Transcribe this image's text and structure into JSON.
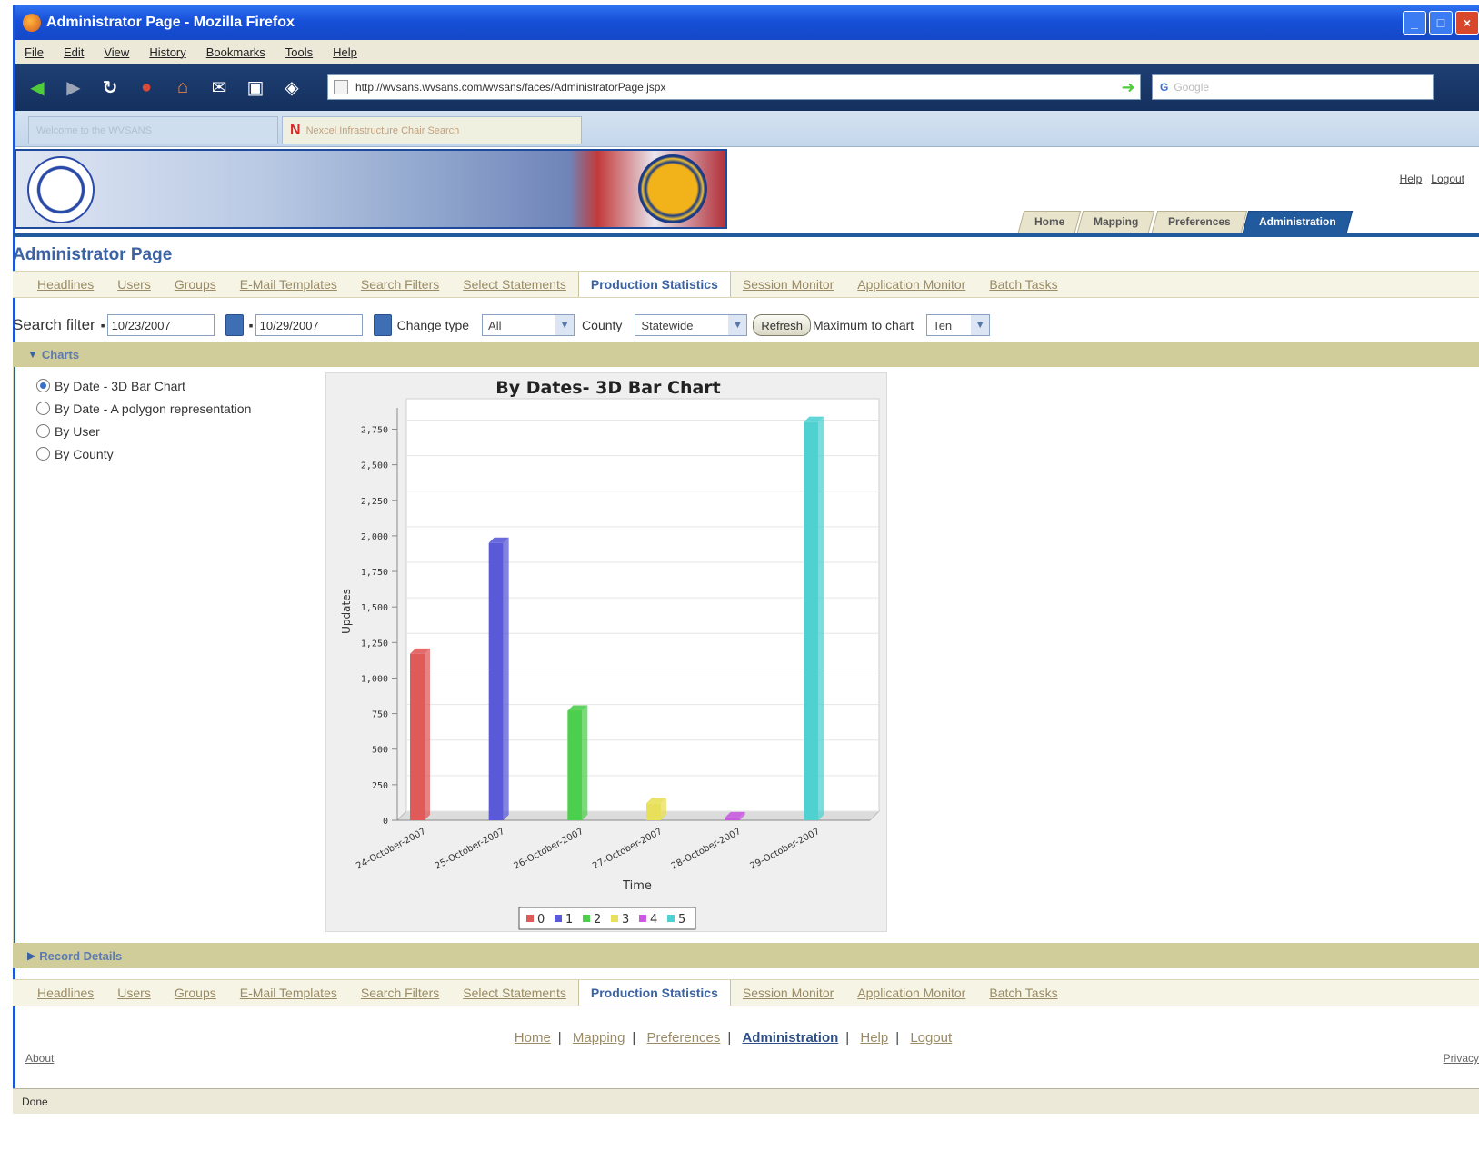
{
  "browser": {
    "window_title": "Administrator Page - Mozilla Firefox",
    "menu": [
      "File",
      "Edit",
      "View",
      "History",
      "Bookmarks",
      "Tools",
      "Help"
    ],
    "url": "http://wvsans.wvsans.com/wvsans/faces/AdministratorPage.jspx",
    "search_placeholder": "Google",
    "tabs": [
      "Welcome to the WVSANS",
      "Nexcel Infrastructure Chair Search"
    ],
    "status": "Done"
  },
  "header": {
    "links": [
      "Help",
      "Logout"
    ],
    "main_tabs": [
      "Home",
      "Mapping",
      "Preferences",
      "Administration"
    ],
    "active_main_tab": "Administration"
  },
  "page": {
    "title": "Administrator Page",
    "subnav": [
      "Headlines",
      "Users",
      "Groups",
      "E-Mail Templates",
      "Search Filters",
      "Select Statements",
      "Production Statistics",
      "Session Monitor",
      "Application Monitor",
      "Batch Tasks"
    ],
    "active_subnav": "Production Statistics"
  },
  "filter": {
    "label": "Search filter",
    "from_date": "10/23/2007",
    "to_date": "10/29/2007",
    "change_type_label": "Change type",
    "change_type_value": "All",
    "county_label": "County",
    "county_value": "Statewide",
    "refresh_label": "Refresh",
    "max_label": "Maximum to chart",
    "max_value": "Ten"
  },
  "charts_section": {
    "title": "Charts",
    "options": [
      "By Date - 3D Bar Chart",
      "By Date - A polygon representation",
      "By User",
      "By County"
    ],
    "selected_index": 0
  },
  "record_section": {
    "title": "Record Details"
  },
  "footer": {
    "links": [
      "Home",
      "Mapping",
      "Preferences",
      "Administration",
      "Help",
      "Logout"
    ],
    "active": "Administration",
    "about": "About",
    "privacy": "Privacy"
  },
  "chart_data": {
    "type": "bar",
    "title": "By Dates- 3D Bar Chart",
    "xlabel": "Time",
    "ylabel": "Updates",
    "categories": [
      "24-October-2007",
      "25-October-2007",
      "26-October-2007",
      "27-October-2007",
      "28-October-2007",
      "29-October-2007"
    ],
    "values": [
      1170,
      1950,
      770,
      120,
      20,
      2800
    ],
    "ylim": [
      0,
      2900
    ],
    "yticks": [
      0,
      250,
      500,
      750,
      1000,
      1250,
      1500,
      1750,
      2000,
      2250,
      2500,
      2750
    ],
    "ytick_labels": [
      "0",
      "250",
      "500",
      "750",
      "1,000",
      "1,250",
      "1,500",
      "1,750",
      "2,000",
      "2,250",
      "2,500",
      "2,750"
    ],
    "legend": [
      "0",
      "1",
      "2",
      "3",
      "4",
      "5"
    ],
    "colors": [
      "#e05a5a",
      "#5a5ad8",
      "#4ccf4c",
      "#e8e05a",
      "#c95ae0",
      "#4fd1d1"
    ],
    "grid": true,
    "legend_position": "bottom"
  }
}
